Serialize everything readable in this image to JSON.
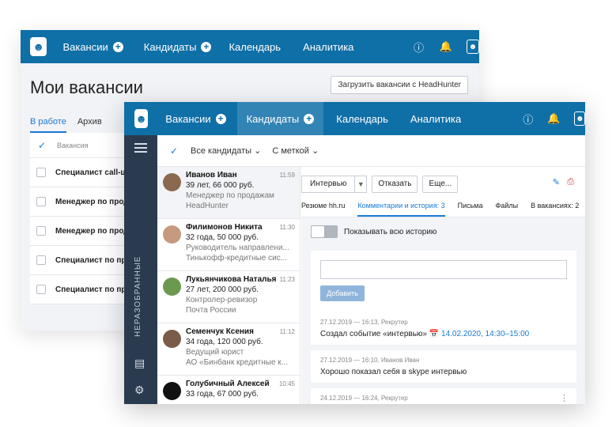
{
  "back": {
    "nav": {
      "vacancies": "Вакансии",
      "candidates": "Кандидаты",
      "calendar": "Календарь",
      "analytics": "Аналитика"
    },
    "title": "Мои вакансии",
    "hh_button": "Загрузить вакансии с HeadHunter",
    "tabs": {
      "active": "В работе",
      "archive": "Архив"
    },
    "list_header": "Вакансия",
    "rows": [
      "Специалист call-ц",
      "Менеджер по прод",
      "Менеджер по прод",
      "Специалист по пр",
      "Специалист по пр"
    ]
  },
  "front": {
    "nav": {
      "vacancies": "Вакансии",
      "candidates": "Кандидаты",
      "calendar": "Календарь",
      "analytics": "Аналитика"
    },
    "sidebar_label": "НЕРАЗОБРАННЫЕ",
    "filters": {
      "all": "Все кандидаты",
      "tag": "С меткой"
    },
    "candidates": [
      {
        "name": "Иванов Иван",
        "time": "11:59",
        "info": "39 лет, 66 000 руб.",
        "position": "Менеджер по продажам",
        "company": "HeadHunter",
        "avatar_color": "#8a6a4e"
      },
      {
        "name": "Филимонов Никита",
        "time": "11:30",
        "info": "32 года, 50 000 руб.",
        "position": "Руководитель направлени...",
        "company": "Тинькофф-кредитные сис...",
        "avatar_color": "#c59a7e"
      },
      {
        "name": "Лукьянчикова Наталья",
        "time": "11:23",
        "info": "27 лет, 200 000 руб.",
        "position": "Контролер-ревизор",
        "company": "Почта России",
        "avatar_color": "#6b9a4e"
      },
      {
        "name": "Семенчук Ксения",
        "time": "11:12",
        "info": "34 года, 120 000 руб.",
        "position": "Ведущий юрист",
        "company": "АО «Бинбанк кредитные к...",
        "avatar_color": "#7a5c48"
      },
      {
        "name": "Голубичный Алексей",
        "time": "10:45",
        "info": "33 года, 67 000 руб.",
        "position": "",
        "company": "",
        "avatar_color": "#111111"
      }
    ],
    "detail": {
      "status": "Интервью",
      "reject": "Отказать",
      "more": "Еще...",
      "tabs": {
        "resume": "Резюме hh.ru",
        "comments": "Комментарии и история: 3",
        "letters": "Письма",
        "files": "Файлы",
        "vacancies": "В вакансиях: 2"
      },
      "show_history": "Показывать всю историю",
      "add_button": "Добавить",
      "events": [
        {
          "meta": "27.12.2019 — 16:13, Рекрутер",
          "text": "Создал событие «интервью»",
          "link": "14.02.2020, 14:30–15:00"
        },
        {
          "meta": "27.12.2019 — 16:10, Иванов Иван",
          "text": "Хорошо показал себя в skype интервью",
          "link": ""
        },
        {
          "meta": "24.12.2019 — 16:24, Рекрутер",
          "text": "",
          "link": ""
        }
      ]
    }
  }
}
